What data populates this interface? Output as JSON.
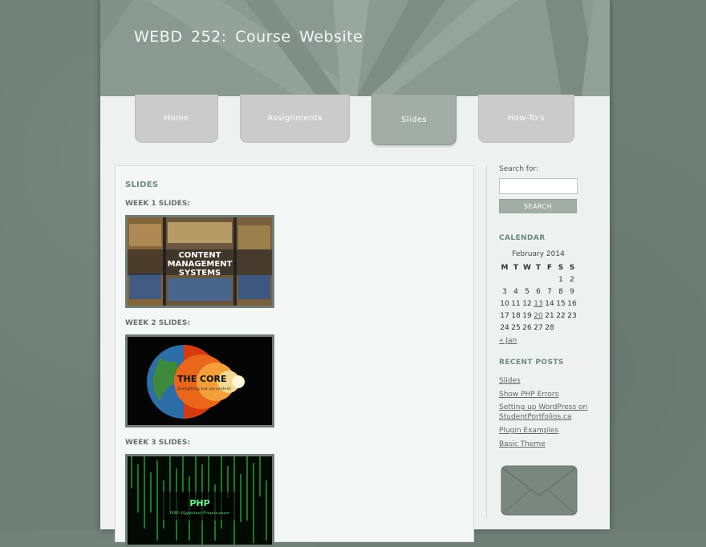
{
  "site": {
    "title": "WEBD 252: Course Website"
  },
  "nav": {
    "items": [
      {
        "label": "Home"
      },
      {
        "label": "Assignments"
      },
      {
        "label": "Slides"
      },
      {
        "label": "How-To's"
      }
    ],
    "active": "Slides"
  },
  "main": {
    "heading": "SLIDES",
    "weeks": [
      {
        "label": "WEEK 1 SLIDES:",
        "thumb_text": [
          "CONTENT",
          "MANAGEMENT",
          "SYSTEMS"
        ]
      },
      {
        "label": "WEEK 2 SLIDES:",
        "thumb_text": [
          "THE CORE",
          "Everything but up-content"
        ]
      },
      {
        "label": "WEEK 3 SLIDES:",
        "thumb_text": [
          "PHP",
          "PHP: Hypertext Preprocessor"
        ]
      }
    ]
  },
  "sidebar": {
    "search_label": "Search for:",
    "search_value": "",
    "search_button": "SEARCH",
    "calendar_heading": "CALENDAR",
    "calendar": {
      "caption": "February 2014",
      "days": [
        "M",
        "T",
        "W",
        "T",
        "F",
        "S",
        "S"
      ],
      "weeks": [
        [
          "",
          "",
          "",
          "",
          "",
          "1",
          "2"
        ],
        [
          "3",
          "4",
          "5",
          "6",
          "7",
          "8",
          "9"
        ],
        [
          "10",
          "11",
          "12",
          "13",
          "14",
          "15",
          "16"
        ],
        [
          "17",
          "18",
          "19",
          "20",
          "21",
          "22",
          "23"
        ],
        [
          "24",
          "25",
          "26",
          "27",
          "28",
          "",
          ""
        ]
      ],
      "linked_days": [
        "13",
        "20"
      ],
      "prev": "« Jan"
    },
    "recent_heading": "RECENT POSTS",
    "recent_posts": [
      "Slides",
      "Show PHP Errors",
      "Setting up WordPress on StudentPortfolios.ca",
      "Plugin Examples",
      "Basic Theme"
    ]
  },
  "colors": {
    "background": "#6e7f78",
    "header": "#8a9a93",
    "page": "#eef1ef",
    "tab": "#cbcbcb",
    "tab_active": "#a3ada8",
    "heading_accent": "#6b8a82"
  },
  "icons": {
    "contact": "envelope-icon"
  }
}
